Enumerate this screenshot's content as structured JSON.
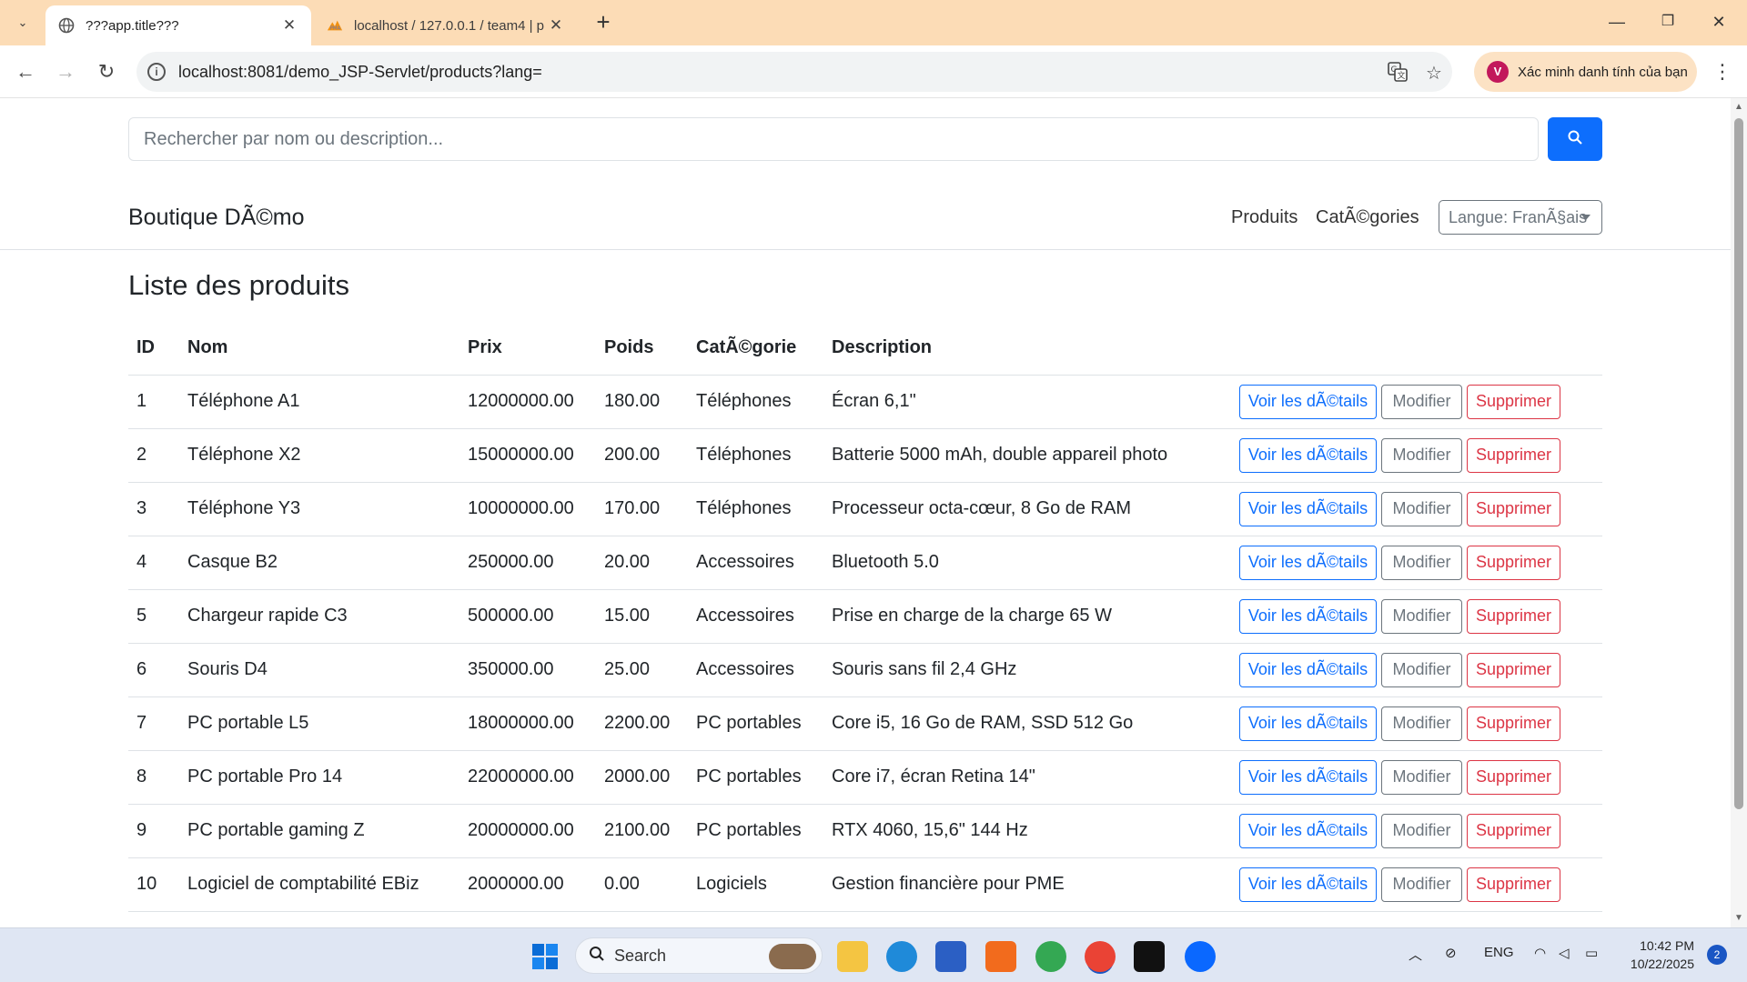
{
  "browser": {
    "tabs": [
      {
        "title": "???app.title???",
        "active": true
      },
      {
        "title": "localhost / 127.0.0.1 / team4 | p",
        "active": false
      }
    ],
    "url": "localhost:8081/demo_JSP-Servlet/products?lang=",
    "profile_label": "Xác minh danh tính của bạn",
    "profile_initial": "V"
  },
  "page": {
    "search_placeholder": "Rechercher par nom ou description...",
    "brand": "Boutique DÃ©mo",
    "nav": {
      "products": "Produits",
      "categories": "CatÃ©gories"
    },
    "language_select": "Langue: FranÃ§ais",
    "title": "Liste des produits",
    "table": {
      "headers": {
        "id": "ID",
        "name": "Nom",
        "price": "Prix",
        "weight": "Poids",
        "category": "CatÃ©gorie",
        "description": "Description"
      },
      "rows": [
        {
          "id": "1",
          "name": "Téléphone A1",
          "price": "12000000.00",
          "weight": "180.00",
          "category": "Téléphones",
          "description": "Écran 6,1\""
        },
        {
          "id": "2",
          "name": "Téléphone X2",
          "price": "15000000.00",
          "weight": "200.00",
          "category": "Téléphones",
          "description": "Batterie 5000 mAh, double appareil photo"
        },
        {
          "id": "3",
          "name": "Téléphone Y3",
          "price": "10000000.00",
          "weight": "170.00",
          "category": "Téléphones",
          "description": "Processeur octa-cœur, 8 Go de RAM"
        },
        {
          "id": "4",
          "name": "Casque B2",
          "price": "250000.00",
          "weight": "20.00",
          "category": "Accessoires",
          "description": "Bluetooth 5.0"
        },
        {
          "id": "5",
          "name": "Chargeur rapide C3",
          "price": "500000.00",
          "weight": "15.00",
          "category": "Accessoires",
          "description": "Prise en charge de la charge 65 W"
        },
        {
          "id": "6",
          "name": "Souris D4",
          "price": "350000.00",
          "weight": "25.00",
          "category": "Accessoires",
          "description": "Souris sans fil 2,4 GHz"
        },
        {
          "id": "7",
          "name": "PC portable L5",
          "price": "18000000.00",
          "weight": "2200.00",
          "category": "PC portables",
          "description": "Core i5, 16 Go de RAM, SSD 512 Go"
        },
        {
          "id": "8",
          "name": "PC portable Pro 14",
          "price": "22000000.00",
          "weight": "2000.00",
          "category": "PC portables",
          "description": "Core i7, écran Retina 14\""
        },
        {
          "id": "9",
          "name": "PC portable gaming Z",
          "price": "20000000.00",
          "weight": "2100.00",
          "category": "PC portables",
          "description": "RTX 4060, 15,6\" 144 Hz"
        },
        {
          "id": "10",
          "name": "Logiciel de comptabilité EBiz",
          "price": "2000000.00",
          "weight": "0.00",
          "category": "Logiciels",
          "description": "Gestion financière pour PME"
        }
      ],
      "actions": {
        "view": "Voir les dÃ©tails",
        "edit": "Modifier",
        "delete": "Supprimer"
      }
    }
  },
  "taskbar": {
    "search_label": "Search",
    "language": "ENG",
    "time": "10:42 PM",
    "date": "10/22/2025",
    "notifications": "2"
  },
  "colors": {
    "primary": "#0d6efd",
    "secondary": "#6c757d",
    "danger": "#dc3545",
    "tabbar": "#fcdcb6"
  }
}
